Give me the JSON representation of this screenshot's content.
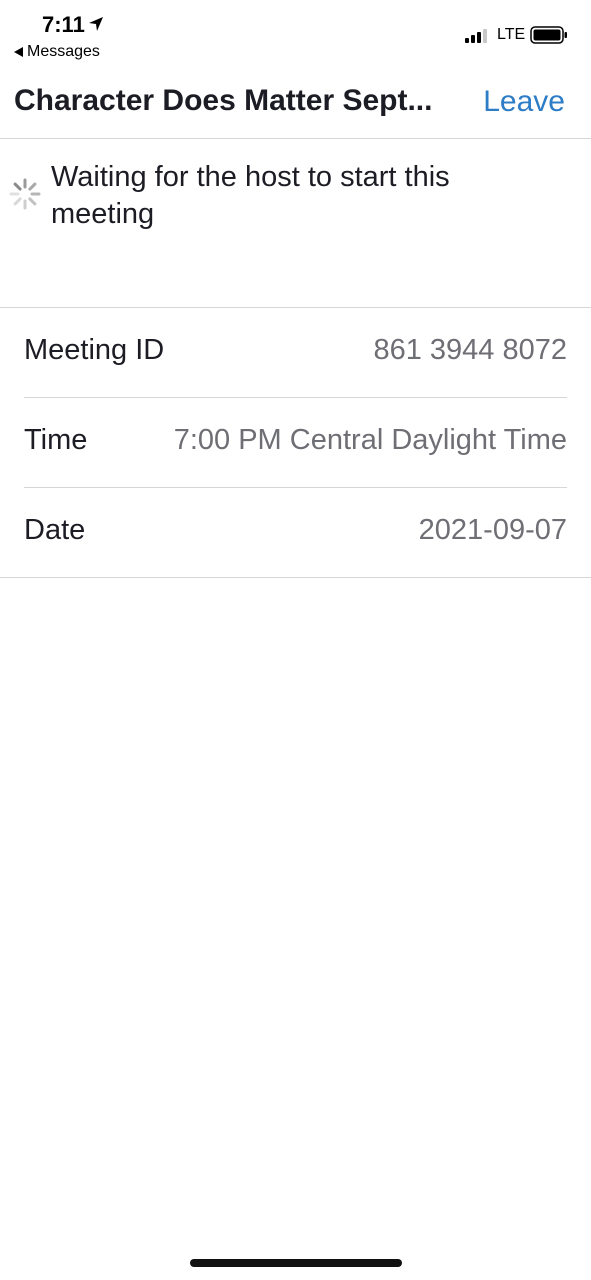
{
  "status_bar": {
    "time": "7:11",
    "back_label": "Messages",
    "network": "LTE",
    "icons": [
      "location-arrow-icon",
      "back-arrow-icon",
      "cellular-signal-icon",
      "battery-icon"
    ]
  },
  "nav": {
    "title": "Character Does Matter Sept...",
    "leave_label": "Leave",
    "accent_color": "#2d7cc6"
  },
  "waiting": {
    "message": "Waiting for the host to start this meeting",
    "icon": "spinner-icon"
  },
  "details": [
    {
      "label": "Meeting ID",
      "value": "861 3944 8072"
    },
    {
      "label": "Time",
      "value": "7:00 PM Central Daylight Time"
    },
    {
      "label": "Date",
      "value": "2021-09-07"
    }
  ]
}
